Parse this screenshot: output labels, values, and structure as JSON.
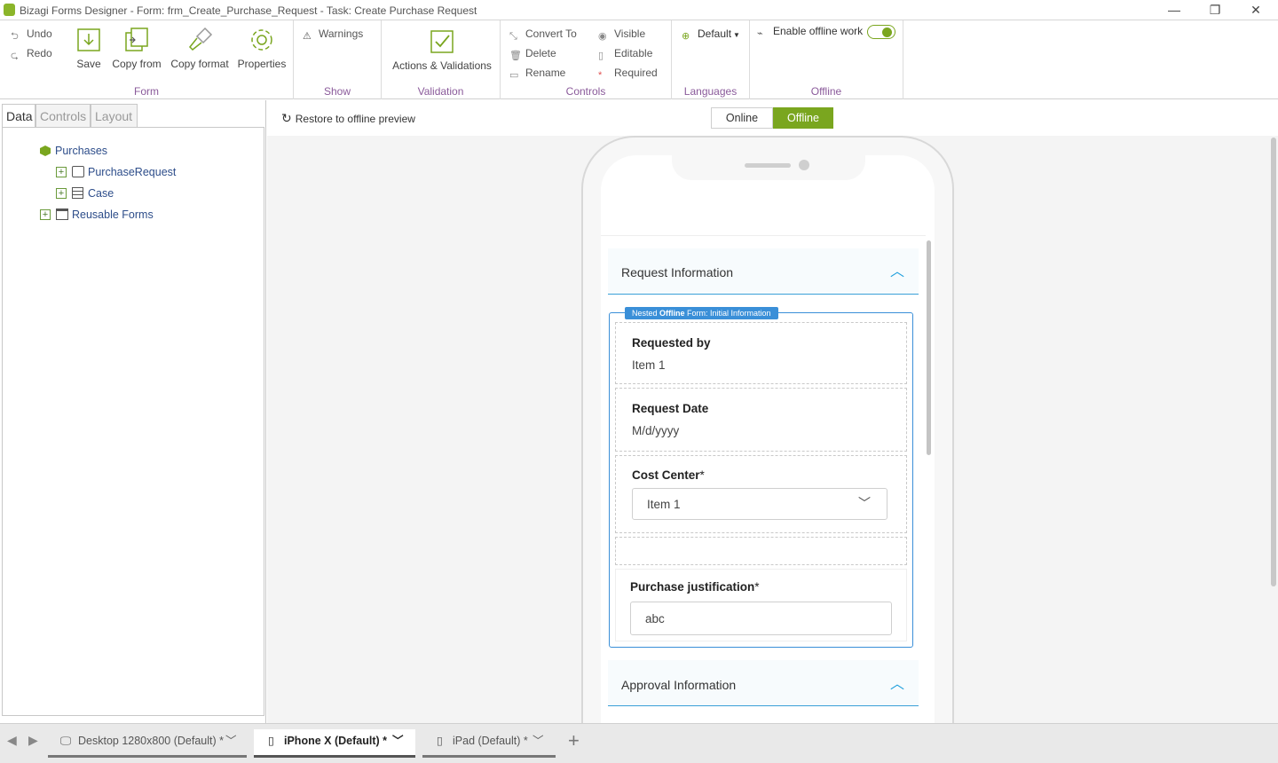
{
  "window": {
    "title": "Bizagi Forms Designer  - Form: frm_Create_Purchase_Request - Task:  Create Purchase Request",
    "minimize": "—",
    "restore": "❐",
    "close": "✕"
  },
  "ribbon": {
    "form_group": {
      "label": "Form",
      "undo": "Undo",
      "redo": "Redo",
      "save": "Save",
      "copy_from": "Copy from",
      "copy_format": "Copy format",
      "properties": "Properties"
    },
    "show_group": {
      "label": "Show",
      "warnings": "Warnings"
    },
    "validation_group": {
      "label": "Validation",
      "actions_validations": "Actions & Validations"
    },
    "controls_group": {
      "label": "Controls",
      "convert_to": "Convert To",
      "delete": "Delete",
      "rename": "Rename",
      "visible": "Visible",
      "editable": "Editable",
      "required": "Required"
    },
    "languages_group": {
      "label": "Languages",
      "default": "Default"
    },
    "offline_group": {
      "label": "Offline",
      "enable_offline": "Enable offline work",
      "toggle_on": true
    }
  },
  "left_panel": {
    "tabs": [
      "Data",
      "Controls",
      "Layout"
    ],
    "active_tab": "Data",
    "tree": {
      "root": "Purchases",
      "purchase_request": "PurchaseRequest",
      "case": "Case",
      "reusable_forms": "Reusable Forms"
    }
  },
  "canvas": {
    "restore_offline": "Restore to offline preview",
    "mode_online": "Online",
    "mode_offline": "Offline",
    "active_mode": "Offline",
    "accent": "#7aa61f"
  },
  "form": {
    "section1": "Request Information",
    "nested_badge_prefix": "Nested ",
    "nested_badge_bold": "Offline",
    "nested_badge_suffix": " Form: Initial Information",
    "requested_by_label": "Requested by",
    "requested_by_value": "Item 1",
    "request_date_label": "Request Date",
    "request_date_placeholder": "M/d/yyyy",
    "cost_center_label": "Cost Center",
    "cost_center_value": "Item 1",
    "justification_label": "Purchase justification",
    "justification_value": "abc",
    "required_mark": "*",
    "section2": "Approval Information"
  },
  "bottom_bar": {
    "desktop": "Desktop 1280x800 (Default)",
    "iphone": "iPhone X (Default)",
    "ipad": "iPad (Default)",
    "modified_mark": "*",
    "add": "+"
  }
}
